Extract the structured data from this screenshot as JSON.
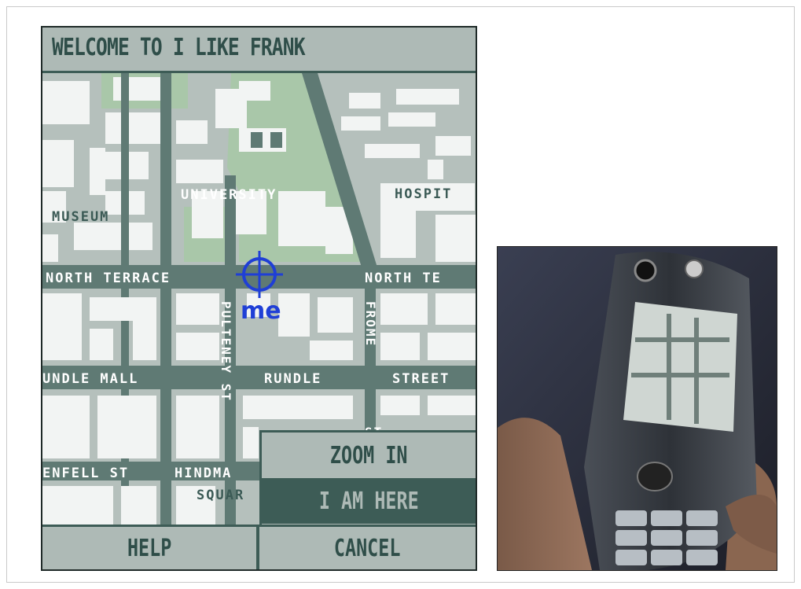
{
  "screen": {
    "title": "WELCOME TO I LIKE FRANK"
  },
  "map": {
    "labels": {
      "university": "UNIVERSITY",
      "hospital": "HOSPIT",
      "museum": "MUSEUM",
      "north_terrace_west": "NORTH TERRACE",
      "north_terrace_east": "NORTH TE",
      "rundle_mall": "UNDLE MALL",
      "rundle": "RUNDLE",
      "street": "STREET",
      "pulteney": "PULTENEY ST",
      "frome": "FROME",
      "st_short": "ST",
      "grenfell": "ENFELL ST",
      "hindmarsh": "HINDMA",
      "square": "SQUAR"
    },
    "marker_label": "me"
  },
  "popup_menu": {
    "zoom_in": "ZOOM IN",
    "i_am_here": "I AM HERE"
  },
  "softkeys": {
    "help": "HELP",
    "cancel": "CANCEL"
  },
  "colors": {
    "road": "#5f7a74",
    "block": "#f2f4f3",
    "park": "#a9c7a9",
    "marker": "#1f3fd6"
  }
}
